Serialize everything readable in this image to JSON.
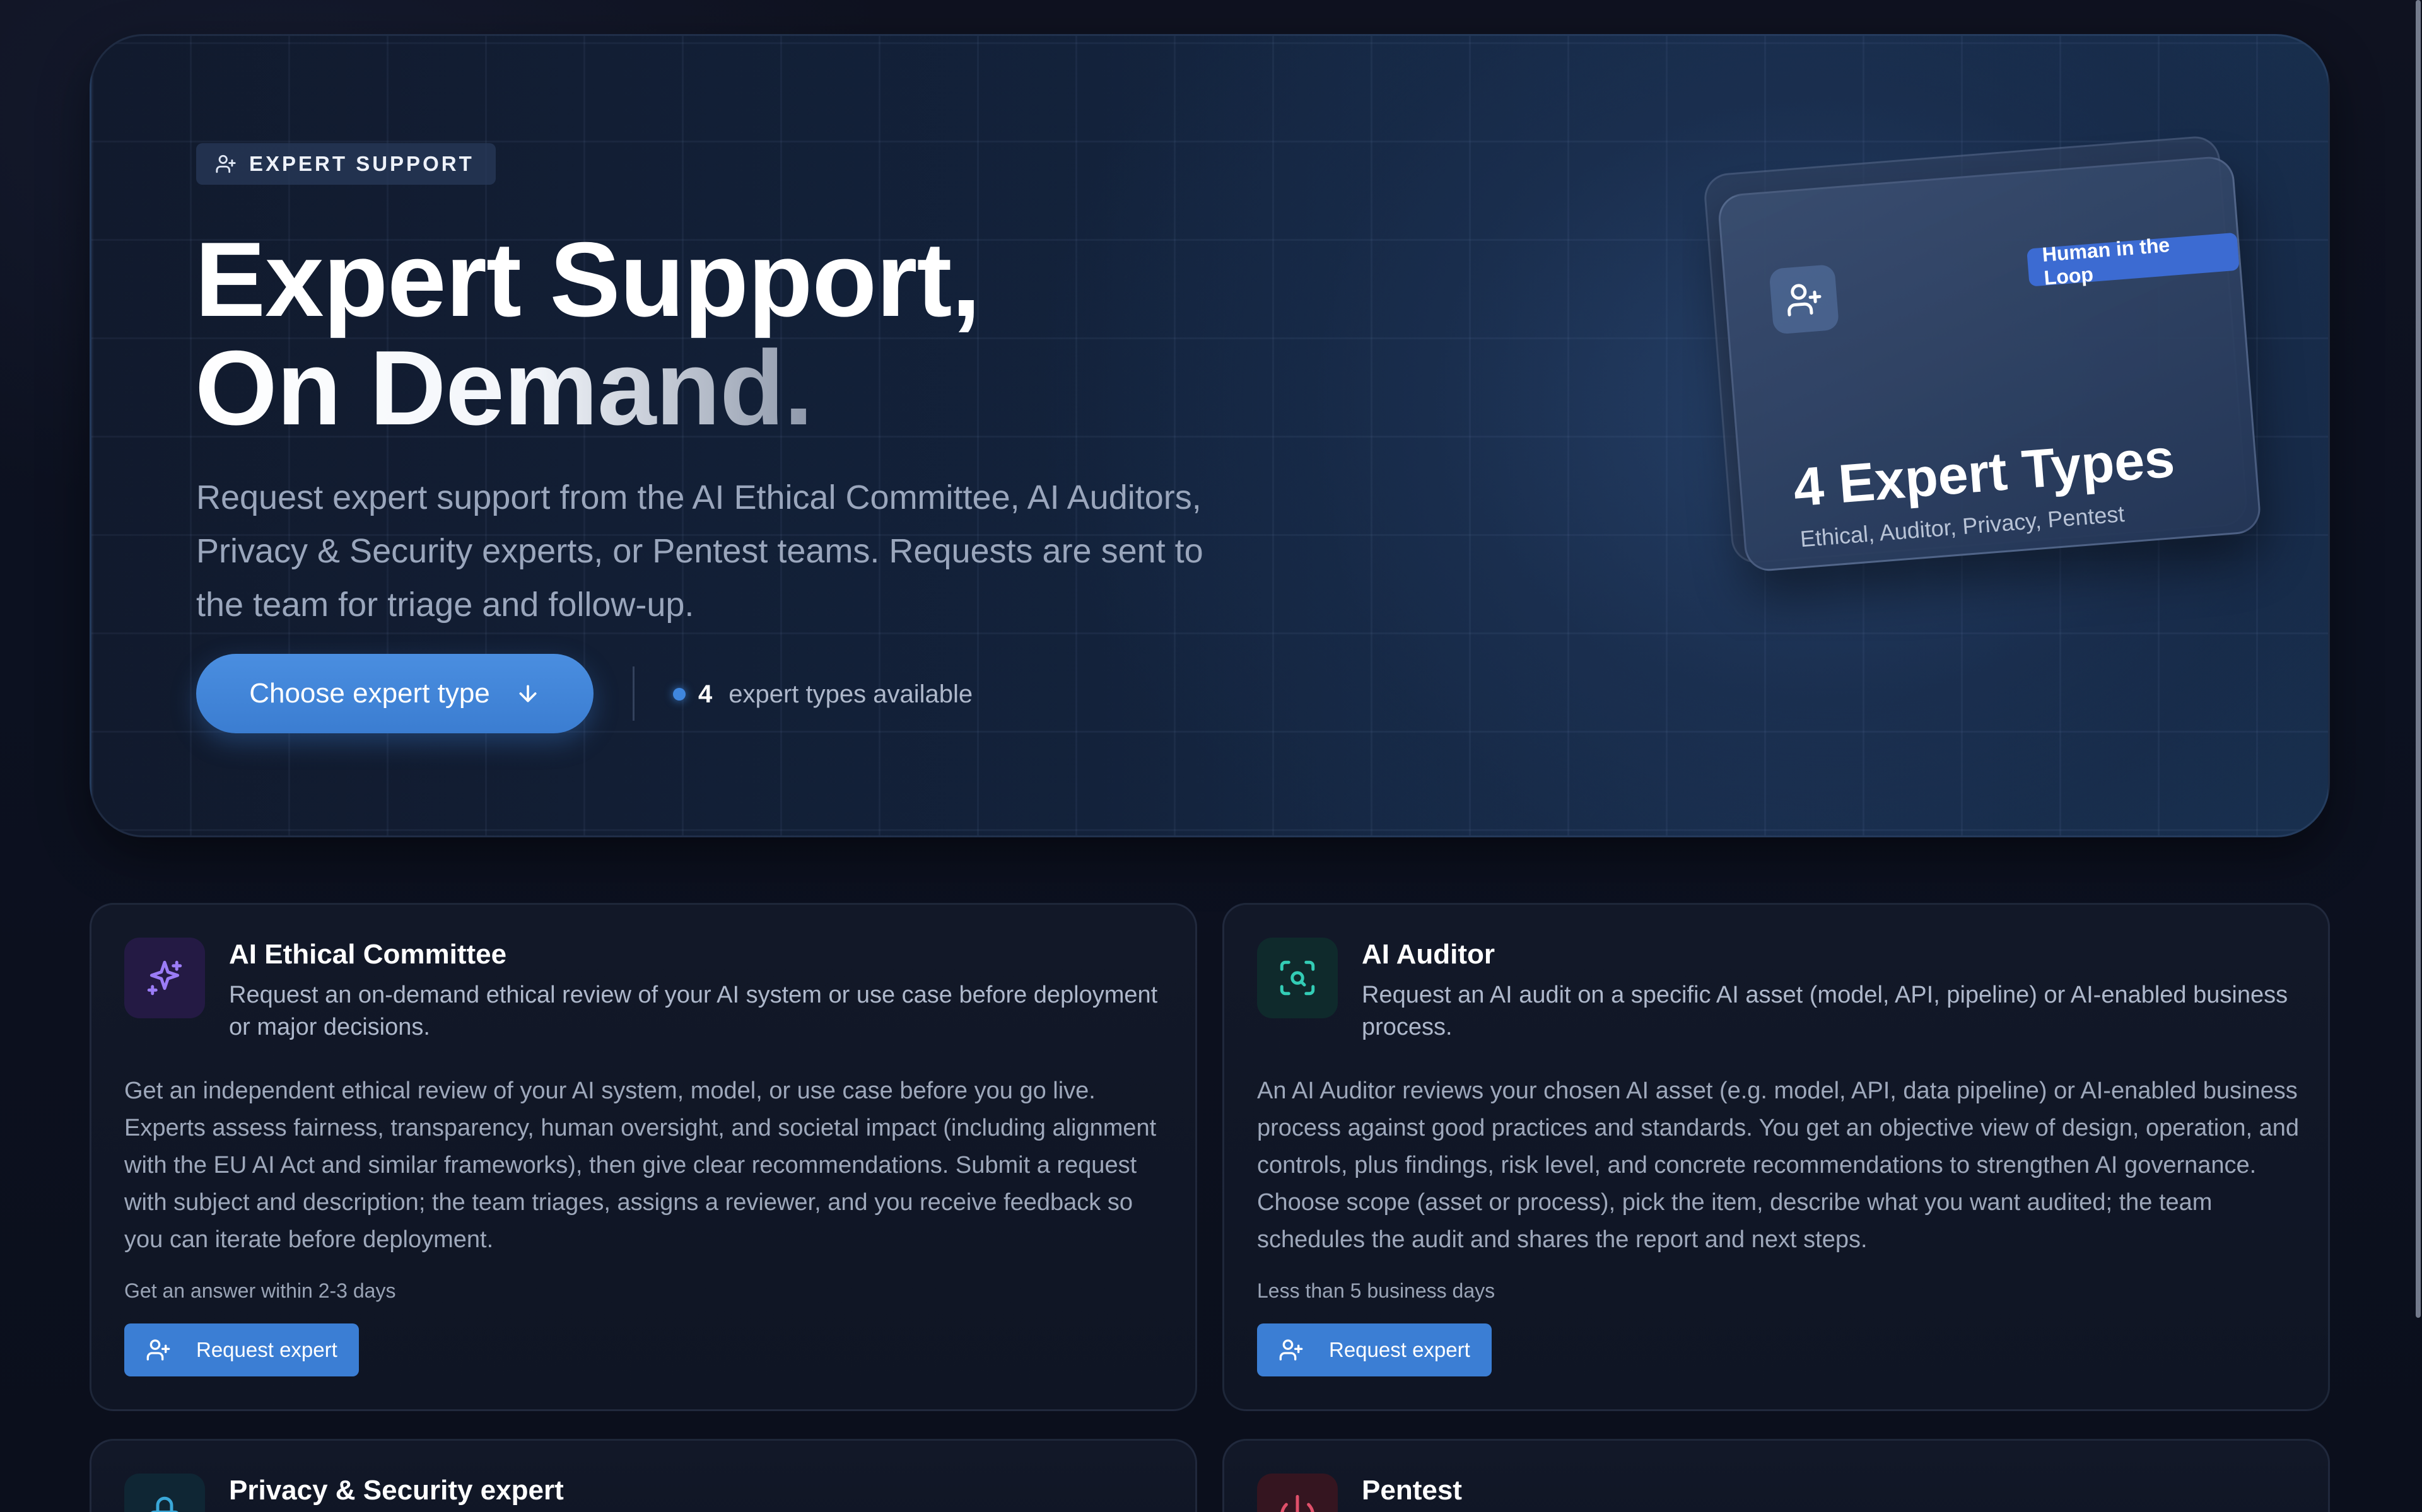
{
  "hero": {
    "eyebrow": "EXPERT SUPPORT",
    "title_line1": "Expert Support,",
    "title_line2": "On Demand.",
    "description": "Request expert support from the AI Ethical Committee, AI Auditors, Privacy & Security experts, or Pentest teams. Requests are sent to the team for triage and follow-up.",
    "cta_label": "Choose expert type",
    "available_count": "4",
    "available_label": "expert types available",
    "stack": {
      "badge": "Human in the Loop",
      "title": "4 Expert Types",
      "subtitle": "Ethical, Auditor, Privacy, Pentest"
    }
  },
  "experts": [
    {
      "title": "AI Ethical Committee",
      "summary": "Request an on-demand ethical review of your AI system or use case before deployment or major decisions.",
      "body": "Get an independent ethical review of your AI system, model, or use case before you go live. Experts assess fairness, transparency, human oversight, and societal impact (including alignment with the EU AI Act and similar frameworks), then give clear recommendations. Submit a request with subject and description; the team triages, assigns a reviewer, and you receive feedback so you can iterate before deployment.",
      "time": "Get an answer within 2-3 days",
      "button": "Request expert",
      "icon": "sparkle-icon",
      "accent": "#8b6cf0"
    },
    {
      "title": "AI Auditor",
      "summary": "Request an AI audit on a specific AI asset (model, API, pipeline) or AI-enabled business process.",
      "body": "An AI Auditor reviews your chosen AI asset (e.g. model, API, data pipeline) or AI-enabled business process against good practices and standards. You get an objective view of design, operation, and controls, plus findings, risk level, and concrete recommendations to strengthen AI governance. Choose scope (asset or process), pick the item, describe what you want audited; the team schedules the audit and shares the report and next steps.",
      "time": "Less than 5 business days",
      "button": "Request expert",
      "icon": "scan-search-icon",
      "accent": "#2fc6b0"
    },
    {
      "title": "Privacy & Security expert",
      "icon": "lock-icon",
      "accent": "#3aa8d8"
    },
    {
      "title": "Pentest",
      "icon": "power-icon",
      "accent": "#e0506a"
    }
  ],
  "colors": {
    "primary": "#3b7ed4",
    "background": "#0b0e18",
    "badge": "#3c6bd2"
  }
}
